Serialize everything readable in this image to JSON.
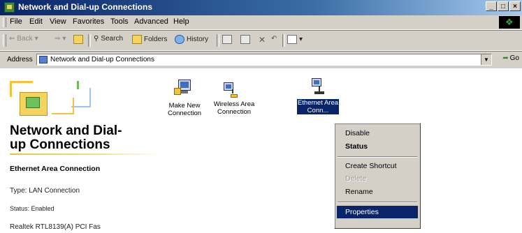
{
  "window": {
    "title": "Network and Dial-up Connections",
    "controls": [
      "_",
      "□",
      "×"
    ]
  },
  "menu": [
    "File",
    "Edit",
    "View",
    "Favorites",
    "Tools",
    "Advanced",
    "Help"
  ],
  "toolbar": {
    "back": "Back",
    "search": "Search",
    "folders": "Folders",
    "history": "History"
  },
  "address": {
    "label": "Address",
    "value": "Network and Dial-up Connections",
    "go": "Go"
  },
  "left_panel": {
    "heading_line1": "Network and Dial-",
    "heading_line2": "up Connections",
    "selected_name": "Ethernet Area Connection",
    "type": "Type: LAN Connection",
    "status": "Status: Enabled",
    "device": "Realtek RTL8139(A) PCI Fas"
  },
  "icons": [
    {
      "line1": "Make New",
      "line2": "Connection"
    },
    {
      "line1": "Wireless Area",
      "line2": "Connection"
    },
    {
      "line1": "Ethernet Area",
      "line2": "Conn..."
    }
  ],
  "context_menu": {
    "disable": "Disable",
    "status": "Status",
    "create_shortcut": "Create Shortcut",
    "delete": "Delete",
    "rename": "Rename",
    "properties": "Properties"
  }
}
